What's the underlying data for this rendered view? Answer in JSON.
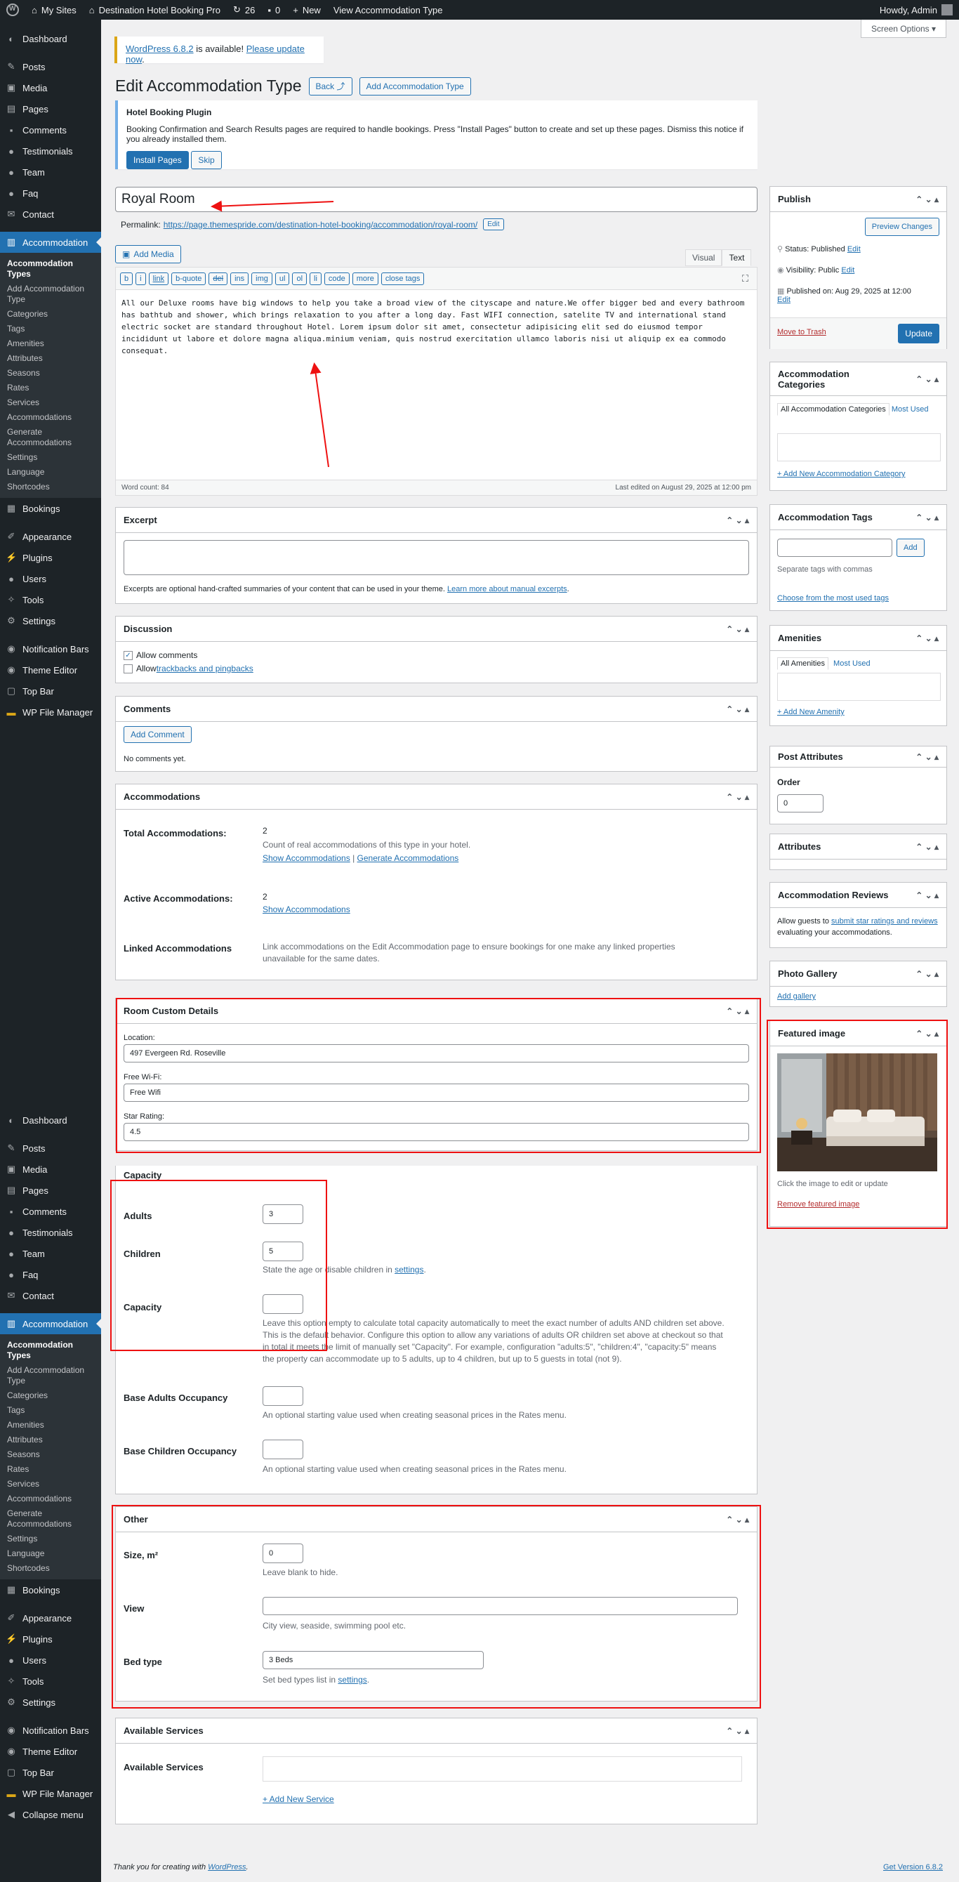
{
  "adminbar": {
    "my_sites": "My Sites",
    "site_name": "Destination Hotel Booking Pro",
    "updates": "26",
    "comments": "0",
    "new": "New",
    "view": "View Accommodation Type",
    "howdy": "Howdy, Admin"
  },
  "menu": {
    "dashboard": "Dashboard",
    "posts": "Posts",
    "media": "Media",
    "pages": "Pages",
    "comments": "Comments",
    "testimonials": "Testimonials",
    "team": "Team",
    "faq": "Faq",
    "contact": "Contact",
    "accommodation": "Accommodation",
    "sub": [
      "Accommodation Types",
      "Add Accommodation Type",
      "Categories",
      "Tags",
      "Amenities",
      "Attributes",
      "Seasons",
      "Rates",
      "Services",
      "Accommodations",
      "Generate Accommodations",
      "Settings",
      "Language",
      "Shortcodes"
    ],
    "bookings": "Bookings",
    "appearance": "Appearance",
    "plugins": "Plugins",
    "users": "Users",
    "tools": "Tools",
    "settings": "Settings",
    "notification_bars": "Notification Bars",
    "theme_editor": "Theme Editor",
    "top_bar": "Top Bar",
    "wp_file_manager": "WP File Manager",
    "collapse": "Collapse menu"
  },
  "screen_options": "Screen Options ▾",
  "update_notice": {
    "version": "WordPress 6.8.2",
    "text": " is available! ",
    "link": "Please update now",
    "end": "."
  },
  "page_title": "Edit Accommodation Type",
  "back_btn": "Back ⤴",
  "add_type_btn": "Add Accommodation Type",
  "plugin_notice": {
    "title": "Hotel Booking Plugin",
    "text": "Booking Confirmation and Search Results pages are required to handle bookings. Press \"Install Pages\" button to create and set up these pages. Dismiss this notice if you already installed them.",
    "install": "Install Pages",
    "skip": "Skip"
  },
  "post_title": "Royal Room",
  "permalink": {
    "label": "Permalink:",
    "url": "https://page.themespride.com/destination-hotel-booking/accommodation/royal-room/",
    "edit": "Edit"
  },
  "editor": {
    "add_media": "Add Media",
    "visual": "Visual",
    "text": "Text",
    "quicktags": [
      "b",
      "i",
      "link",
      "b-quote",
      "del",
      "ins",
      "img",
      "ul",
      "ol",
      "li",
      "code",
      "more",
      "close tags"
    ],
    "content": "All our Deluxe rooms have big windows to help you take a broad view of the cityscape and nature.We offer bigger bed and every bathroom has bathtub and shower, which brings relaxation to you after a long day. Fast WIFI connection, satelite TV and international stand electric socket are standard throughout Hotel. Lorem ipsum dolor sit amet, consectetur adipisicing elit sed do eiusmod tempor incididunt ut labore et dolore magna aliqua.minium veniam, quis nostrud exercitation ullamco laboris nisi ut aliquip ex ea commodo consequat.",
    "word_count": "Word count: 84",
    "last_edited": "Last edited on August 29, 2025 at 12:00 pm"
  },
  "excerpt": {
    "title": "Excerpt",
    "help": "Excerpts are optional hand-crafted summaries of your content that can be used in your theme. ",
    "link": "Learn more about manual excerpts",
    "end": "."
  },
  "discussion": {
    "title": "Discussion",
    "allow_comments": "Allow comments",
    "allow_pre": "Allow ",
    "trackbacks": "trackbacks and pingbacks"
  },
  "comments_box": {
    "title": "Comments",
    "add": "Add Comment",
    "none": "No comments yet."
  },
  "accommodations": {
    "title": "Accommodations",
    "total_label": "Total Accommodations:",
    "total_value": "2",
    "total_desc": "Count of real accommodations of this type in your hotel.",
    "show": "Show Accommodations",
    "sep": " | ",
    "generate": "Generate Accommodations",
    "active_label": "Active Accommodations:",
    "active_value": "2",
    "linked_label": "Linked Accommodations",
    "linked_desc": "Link accommodations on the Edit Accommodation page to ensure bookings for one make any linked properties unavailable for the same dates."
  },
  "custom": {
    "title": "Room Custom Details",
    "location_label": "Location:",
    "location": "497 Evergeen Rd. Roseville",
    "wifi_label": "Free Wi-Fi:",
    "wifi": "Free Wifi",
    "rating_label": "Star Rating:",
    "rating": "4.5"
  },
  "capacity": {
    "title": "Capacity",
    "adults_label": "Adults",
    "adults": "3",
    "children_label": "Children",
    "children": "5",
    "children_desc": "State the age or disable children in ",
    "settings_link": "settings",
    "capacity_label": "Capacity",
    "capacity_desc": "Leave this option empty to calculate total capacity automatically to meet the exact number of adults AND children set above. This is the default behavior. Configure this option to allow any variations of adults OR children set above at checkout so that in total it meets the limit of manually set \"Capacity\". For example, configuration \"adults:5\", \"children:4\", \"capacity:5\" means the property can accommodate up to 5 adults, up to 4 children, but up to 5 guests in total (not 9).",
    "base_adults_label": "Base Adults Occupancy",
    "base_adults_desc": "An optional starting value used when creating seasonal prices in the Rates menu.",
    "base_children_label": "Base Children Occupancy",
    "base_children_desc": "An optional starting value used when creating seasonal prices in the Rates menu."
  },
  "other": {
    "title": "Other",
    "size_label": "Size, m²",
    "size": "0",
    "size_desc": "Leave blank to hide.",
    "view_label": "View",
    "view_desc": "City view, seaside, swimming pool etc.",
    "bed_label": "Bed type",
    "bed": "3 Beds",
    "bed_desc": "Set bed types list in ",
    "settings_link": "settings",
    "end": "."
  },
  "services": {
    "title": "Available Services",
    "label": "Available Services",
    "add": "+ Add New Service"
  },
  "footer": {
    "thanks": "Thank you for creating with ",
    "wp": "WordPress",
    "end": ".",
    "version": "Get Version 6.8.2"
  },
  "publish": {
    "title": "Publish",
    "preview": "Preview Changes",
    "status": "Status: ",
    "status_val": "Published",
    "visibility": "Visibility: ",
    "visibility_val": "Public",
    "published_on": "Published on: ",
    "published_val": "Aug 29, 2025 at 12:00",
    "edit": "Edit",
    "trash": "Move to Trash",
    "update": "Update"
  },
  "acc_categories": {
    "title": "Accommodation Categories",
    "tab_all": "All Accommodation Categories",
    "tab_most": "Most Used",
    "add": "+ Add New Accommodation Category"
  },
  "acc_tags": {
    "title": "Accommodation Tags",
    "add": "Add",
    "help": "Separate tags with commas",
    "choose": "Choose from the most used tags"
  },
  "amenities": {
    "title": "Amenities",
    "tab_all": "All Amenities",
    "tab_most": "Most Used",
    "add": "+ Add New Amenity"
  },
  "post_attributes": {
    "title": "Post Attributes",
    "order_label": "Order",
    "order": "0"
  },
  "attributes": {
    "title": "Attributes"
  },
  "reviews": {
    "title": "Accommodation Reviews",
    "pre": "Allow guests to ",
    "link": "submit star ratings and reviews",
    "post": " evaluating your accommodations."
  },
  "gallery": {
    "title": "Photo Gallery",
    "add": "Add gallery"
  },
  "featured": {
    "title": "Featured image",
    "help": "Click the image to edit or update",
    "remove": "Remove featured image"
  },
  "colors": {
    "accent": "#2271b1",
    "sidebar": "#1d2327",
    "annotation": "#e11111"
  }
}
